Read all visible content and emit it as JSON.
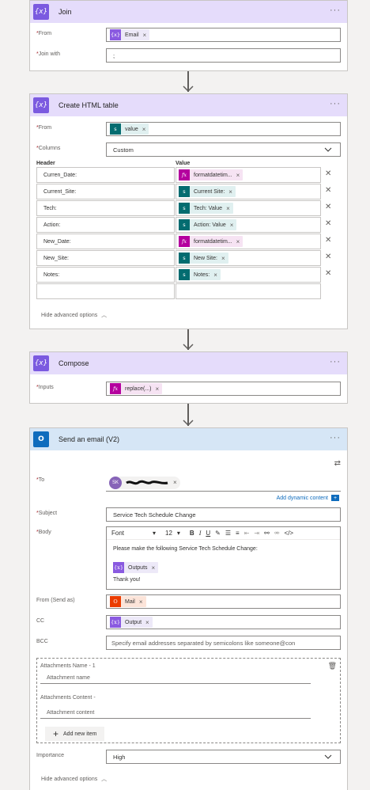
{
  "join": {
    "title": "Join",
    "icon": "{x}",
    "from_label": "From",
    "from_token": "Email",
    "join_with_label": "Join with",
    "join_with_value": ";"
  },
  "html_table": {
    "title": "Create HTML table",
    "icon": "{x}",
    "from_label": "From",
    "from_token": "value",
    "columns_label": "Columns",
    "columns_value": "Custom",
    "header_label": "Header",
    "value_label": "Value",
    "rows": [
      {
        "header": "Curren_Date:",
        "value": "formatdatetim...",
        "kind": "fx"
      },
      {
        "header": "Current_Site:",
        "value": "Current Site:",
        "kind": "sp"
      },
      {
        "header": "Tech:",
        "value": "Tech: Value",
        "kind": "sp"
      },
      {
        "header": "Action:",
        "value": "Action: Value",
        "kind": "sp"
      },
      {
        "header": "New_Date:",
        "value": "formatdatetim...",
        "kind": "fx"
      },
      {
        "header": "New_Site:",
        "value": "New Site:",
        "kind": "sp"
      },
      {
        "header": "Notes:",
        "value": "Notes:",
        "kind": "sp"
      }
    ],
    "hide_advanced": "Hide advanced options"
  },
  "compose": {
    "title": "Compose",
    "icon": "{x}",
    "inputs_label": "Inputs",
    "inputs_token": "replace(...)"
  },
  "email": {
    "title": "Send an email (V2)",
    "icon": "O",
    "to_label": "To",
    "to_avatar": "SK",
    "add_dynamic": "Add dynamic content",
    "subject_label": "Subject",
    "subject_value": "Service Tech Schedule Change",
    "body_label": "Body",
    "font_name": "Font",
    "font_size": "12",
    "body_line1": "Please make the following Service Tech Schedule Change:",
    "body_token": "Outputs",
    "body_line2": "Thank you!",
    "from_label": "From (Send as)",
    "from_token": "Mail",
    "cc_label": "CC",
    "cc_token": "Output",
    "bcc_label": "BCC",
    "bcc_placeholder": "Specify email addresses separated by semicolons like someone@con",
    "attach_name_label": "Attachments Name - 1",
    "attach_name_placeholder": "Attachment name",
    "attach_content_label": "Attachments Content -",
    "attach_content_placeholder": "Attachment content",
    "add_new_item": "Add new item",
    "importance_label": "Importance",
    "importance_value": "High",
    "hide_advanced": "Hide advanced options"
  },
  "colors": {
    "action_header": "#e5dcfb",
    "email_header": "#d6e6f6",
    "variable_icon": "#7b5ae0",
    "expression_icon": "#b4009e",
    "sharepoint_icon": "#036c70",
    "link": "#0f6cbd"
  }
}
